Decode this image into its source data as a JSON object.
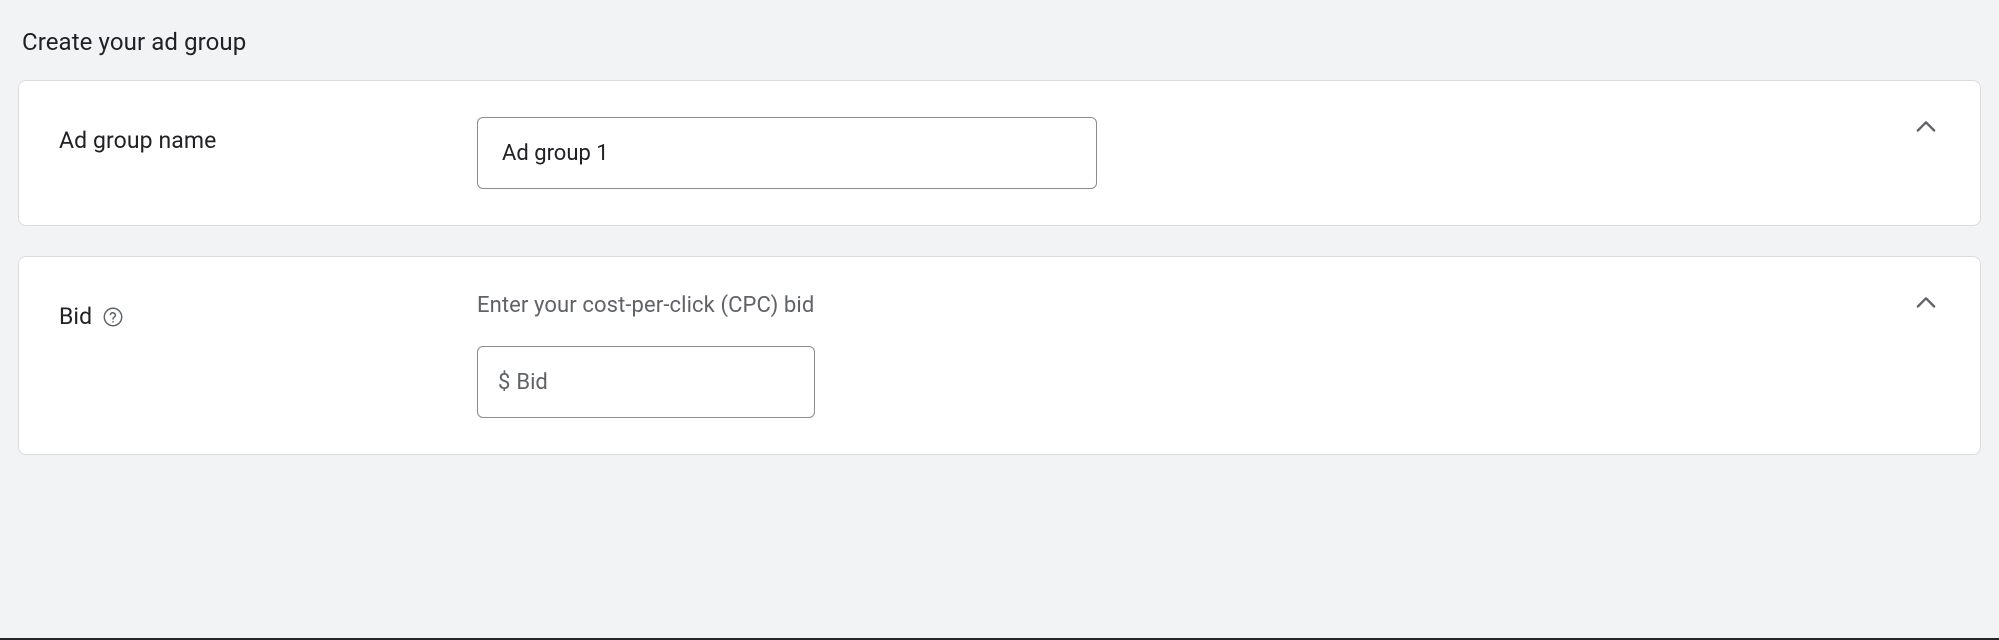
{
  "page": {
    "title": "Create your ad group"
  },
  "adGroupName": {
    "label": "Ad group name",
    "value": "Ad group 1"
  },
  "bid": {
    "label": "Bid",
    "hint": "Enter your cost-per-click (CPC) bid",
    "currencySymbol": "$",
    "placeholder": "Bid",
    "value": ""
  }
}
